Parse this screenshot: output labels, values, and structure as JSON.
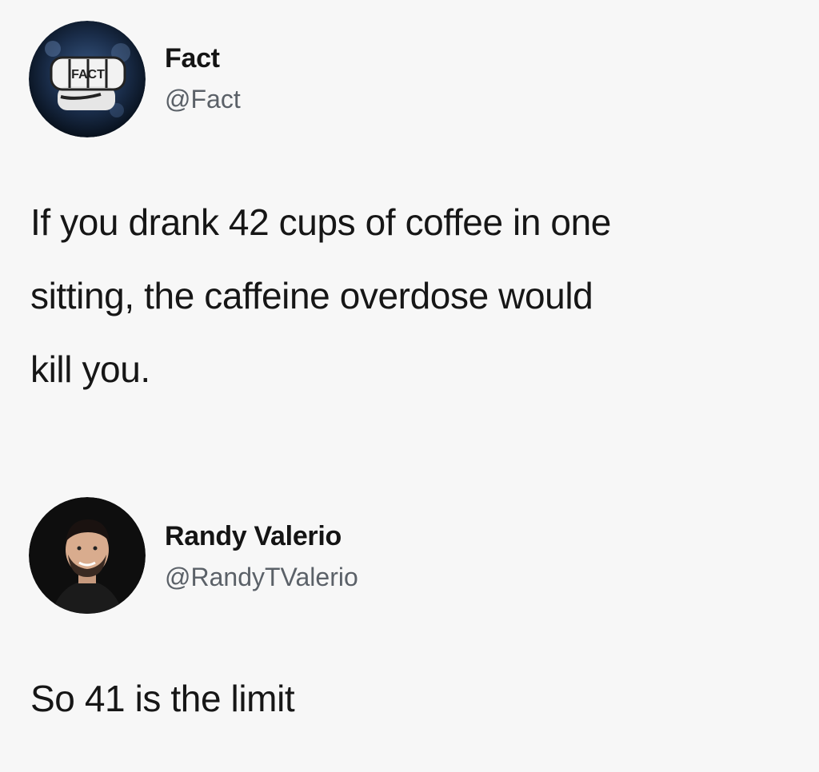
{
  "tweets": [
    {
      "display_name": "Fact",
      "handle": "@Fact",
      "text_lines": [
        "If you drank 42 cups of coffee in one",
        "sitting, the caffeine overdose would",
        "kill you."
      ],
      "avatar_icon": "fact-fist-logo-icon",
      "avatar_fist_label": "FACT"
    },
    {
      "display_name": "Randy Valerio",
      "handle": "@RandyTValerio",
      "text_lines": [
        "So 41 is the limit"
      ],
      "avatar_icon": "user-photo-avatar"
    }
  ],
  "colors": {
    "background": "#f7f7f7",
    "text": "#161616",
    "handle": "#5b6168",
    "fact_avatar_bg": "#0d1a2c"
  }
}
